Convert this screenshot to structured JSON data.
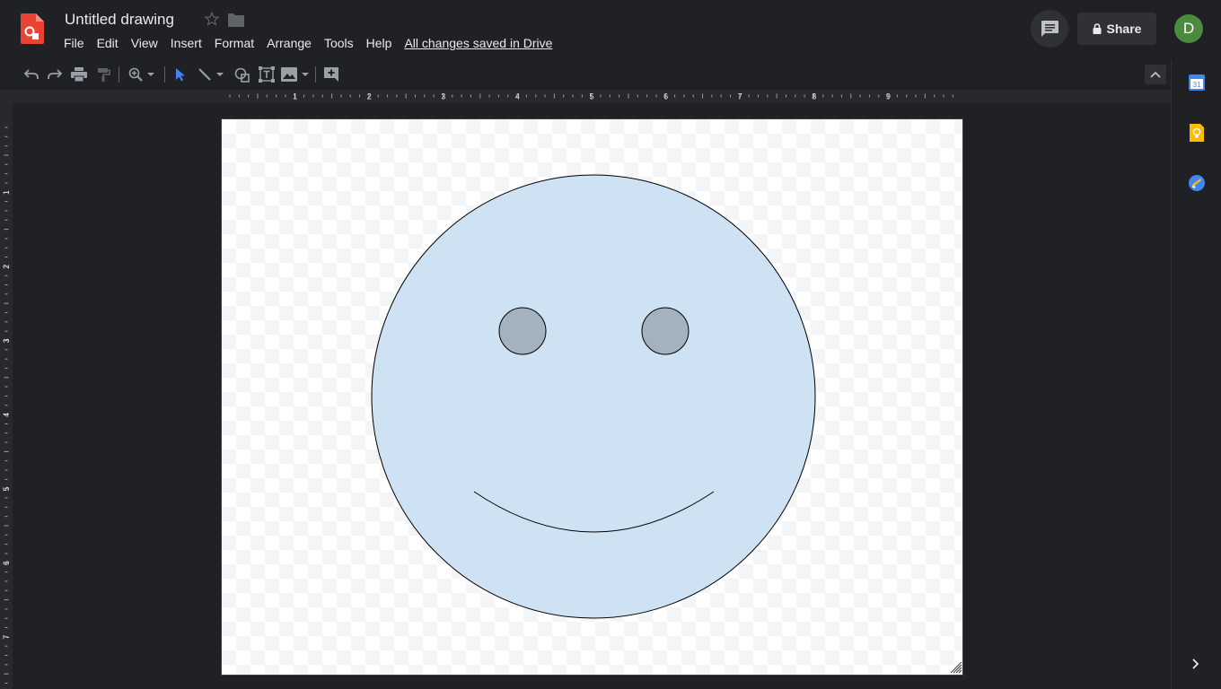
{
  "header": {
    "title": "Untitled drawing",
    "save_status": "All changes saved in Drive",
    "share_label": "Share",
    "avatar_initial": "D"
  },
  "menu": [
    "File",
    "Edit",
    "View",
    "Insert",
    "Format",
    "Arrange",
    "Tools",
    "Help"
  ],
  "toolbar": {
    "tools": [
      "undo-icon",
      "redo-icon",
      "print-icon",
      "paint-format-icon",
      "zoom-icon",
      "select-icon",
      "line-icon",
      "shape-icon",
      "text-box-icon",
      "image-icon",
      "add-comment-icon"
    ]
  },
  "rulers": {
    "horizontal_labels": [
      "1",
      "2",
      "3",
      "4",
      "5",
      "6",
      "7",
      "8",
      "9"
    ],
    "vertical_labels": [
      "1",
      "2",
      "3",
      "4",
      "5",
      "6",
      "7"
    ]
  },
  "side_panel": {
    "apps": [
      "calendar-icon",
      "keep-icon",
      "tasks-icon"
    ],
    "calendar_day": "31"
  },
  "colors": {
    "face_fill": "#cfe2f3",
    "eye_fill": "#a4b2bf",
    "outline": "#000000",
    "accent_blue": "#4285f4",
    "brand_red": "#ea4335",
    "keep_yellow": "#fbbc04",
    "avatar_green": "#4b8a3f"
  }
}
